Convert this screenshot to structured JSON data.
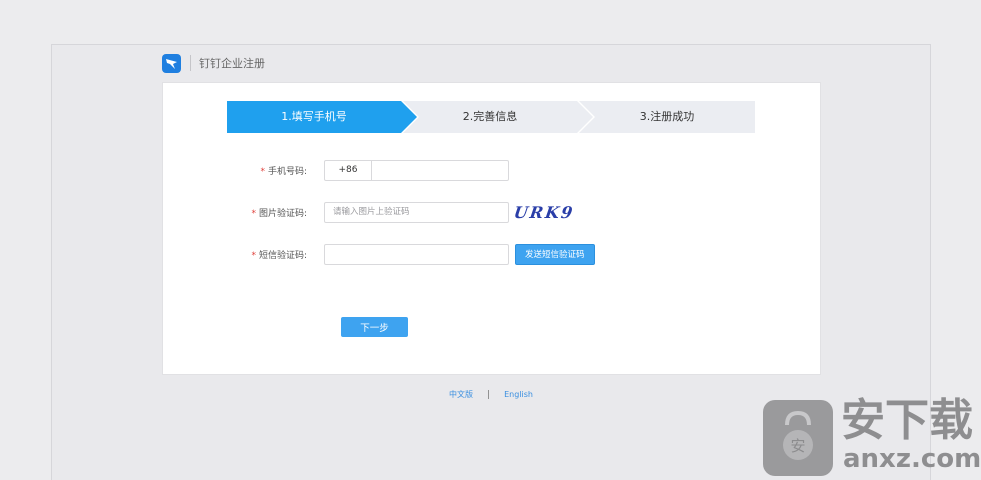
{
  "header": {
    "title": "钉钉企业注册"
  },
  "steps": [
    {
      "label": "1.填写手机号",
      "active": true
    },
    {
      "label": "2.完善信息",
      "active": false
    },
    {
      "label": "3.注册成功",
      "active": false
    }
  ],
  "colors": {
    "active_step": "#1fa0ee",
    "inactive_step": "#ebedf2",
    "button": "#3ea3f0",
    "required": "#e0403a"
  },
  "form": {
    "required_mark": "*",
    "phone": {
      "label": "手机号码:",
      "country_code": "+86",
      "value": ""
    },
    "captcha": {
      "label": "图片验证码:",
      "placeholder": "请输入图片上验证码",
      "image_text": "URK9"
    },
    "sms": {
      "label": "短信验证码:",
      "value": "",
      "send_button": "发送短信验证码"
    },
    "next_button": "下一步"
  },
  "footer": {
    "lang_cn": "中文版",
    "separator": "|",
    "lang_en": "English"
  },
  "watermark": {
    "name": "安下载",
    "url": "anxz.com"
  }
}
